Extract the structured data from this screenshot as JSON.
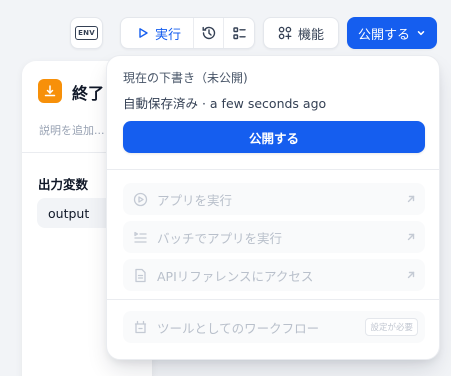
{
  "toolbar": {
    "env_label": "ENV",
    "run_label": "実行",
    "feature_label": "機能",
    "publish_label": "公開する"
  },
  "end_node": {
    "title": "終了",
    "description_placeholder": "説明を追加...",
    "output_section_label": "出力変数",
    "output_var": "output"
  },
  "publish_menu": {
    "status": "現在の下書き（未公開)",
    "autosave": "自動保存済み · a few seconds ago",
    "publish_button": "公開する",
    "items": [
      {
        "label": "アプリを実行",
        "icon": "play-circle-icon"
      },
      {
        "label": "バッチでアプリを実行",
        "icon": "batch-list-icon"
      },
      {
        "label": "APIリファレンスにアクセス",
        "icon": "document-icon"
      }
    ],
    "workflow_tool": {
      "label": "ツールとしてのワークフロー",
      "tag": "設定が必要"
    }
  },
  "colors": {
    "primary": "#155eef",
    "end_node_icon": "#f79009",
    "disabled_text": "#b9c0cb"
  }
}
